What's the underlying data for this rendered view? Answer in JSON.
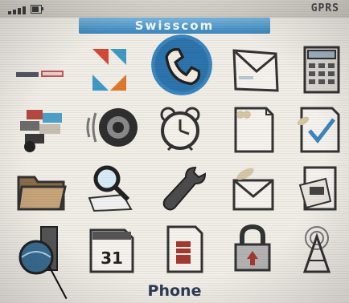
{
  "status": {
    "network": "GPRS",
    "signal_bars": 4,
    "battery_percent": 70
  },
  "carrier": "Swisscom",
  "icons": [
    {
      "name": "phone-icon",
      "selected": true
    },
    {
      "name": "sms-icon"
    },
    {
      "name": "transfer-arrows-icon"
    },
    {
      "name": "messages-envelope-icon"
    },
    {
      "name": "calculator-icon"
    },
    {
      "name": "contacts-blocks-icon"
    },
    {
      "name": "speaker-icon"
    },
    {
      "name": "alarm-clock-icon"
    },
    {
      "name": "saved-messages-icon"
    },
    {
      "name": "tasks-icon"
    },
    {
      "name": "folder-icon"
    },
    {
      "name": "search-icon"
    },
    {
      "name": "options-wrench-icon"
    },
    {
      "name": "compose-icon"
    },
    {
      "name": "help-icon"
    },
    {
      "name": "browser-globe-icon"
    },
    {
      "name": "calendar-icon"
    },
    {
      "name": "memopad-icon"
    },
    {
      "name": "security-lock-icon"
    },
    {
      "name": "bluetooth-tower-icon"
    }
  ],
  "calendar_day": "31",
  "selected_label": "Phone",
  "colors": {
    "accent": "#3a86be",
    "background": "#f1eee8",
    "label": "#2c3c55"
  }
}
